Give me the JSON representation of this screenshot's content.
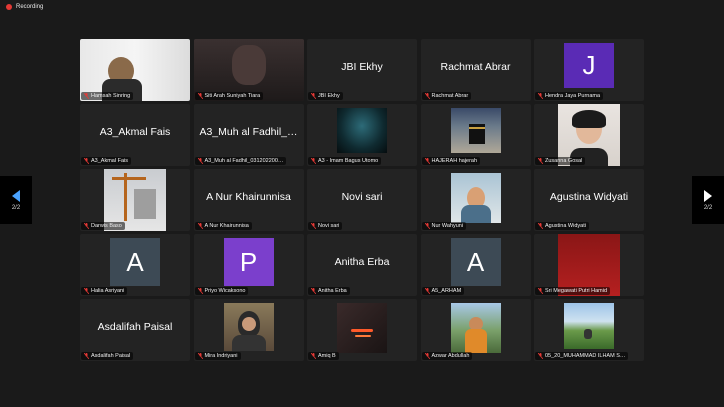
{
  "recording": {
    "label": "Recording"
  },
  "pager": {
    "left": "2/2",
    "right": "2/2"
  },
  "colors": {
    "avatar_j": "#5a2bb5",
    "avatar_p": "#7b3fcc",
    "avatar_a": "#3d4a55",
    "recording_dot": "#e53935",
    "mic_muted": "#e53935"
  },
  "tiles": [
    {
      "name": "Hamsah Sinring",
      "big": "",
      "kind": "photo"
    },
    {
      "name": "Siti Arah Suniyah Tiara",
      "big": "",
      "kind": "photo"
    },
    {
      "name": "JBI Ekhy",
      "big": "JBI Ekhy",
      "kind": "text"
    },
    {
      "name": "Rachmat Abrar",
      "big": "Rachmat Abrar",
      "kind": "text"
    },
    {
      "name": "Hendra Jaya Purnama",
      "big": "J",
      "kind": "avatar"
    },
    {
      "name": "A3_Akmal Fais",
      "big": "A3_Akmal Fais",
      "kind": "text"
    },
    {
      "name": "A3_Muh al Fadhil_031202200…",
      "big": "A3_Muh al Fadhil_…",
      "kind": "text"
    },
    {
      "name": "A3 - Imam Bagus Utomo",
      "big": "",
      "kind": "photo"
    },
    {
      "name": "HAJERAH hajerah",
      "big": "",
      "kind": "photo"
    },
    {
      "name": "Zusanna Gosal",
      "big": "",
      "kind": "photo"
    },
    {
      "name": "Darwis Baso",
      "big": "",
      "kind": "photo"
    },
    {
      "name": "A Nur Khairunnisa",
      "big": "A Nur Khairunnisa",
      "kind": "text"
    },
    {
      "name": "Novi sari",
      "big": "Novi sari",
      "kind": "text"
    },
    {
      "name": "Nur Wahyuni",
      "big": "",
      "kind": "photo"
    },
    {
      "name": "Agustina Widyati",
      "big": "Agustina Widyati",
      "kind": "text"
    },
    {
      "name": "Halia Asriyani",
      "big": "A",
      "kind": "avatar"
    },
    {
      "name": "Priyo Wicaksono",
      "big": "P",
      "kind": "avatar"
    },
    {
      "name": "Anitha Erba",
      "big": "Anitha Erba",
      "kind": "text"
    },
    {
      "name": "A5_ARHAM",
      "big": "A",
      "kind": "avatar"
    },
    {
      "name": "Sri Megawati Putri Hamid",
      "big": "",
      "kind": "photo"
    },
    {
      "name": "Asdalifah Paisal",
      "big": "Asdalifah Paisal",
      "kind": "text"
    },
    {
      "name": "Mira Indriyani",
      "big": "",
      "kind": "photo"
    },
    {
      "name": "Amiq B",
      "big": "",
      "kind": "photo"
    },
    {
      "name": "Azwar Abdullah",
      "big": "",
      "kind": "photo"
    },
    {
      "name": "05_20_MUHAMMAD ILHAM S…",
      "big": "",
      "kind": "photo"
    }
  ]
}
